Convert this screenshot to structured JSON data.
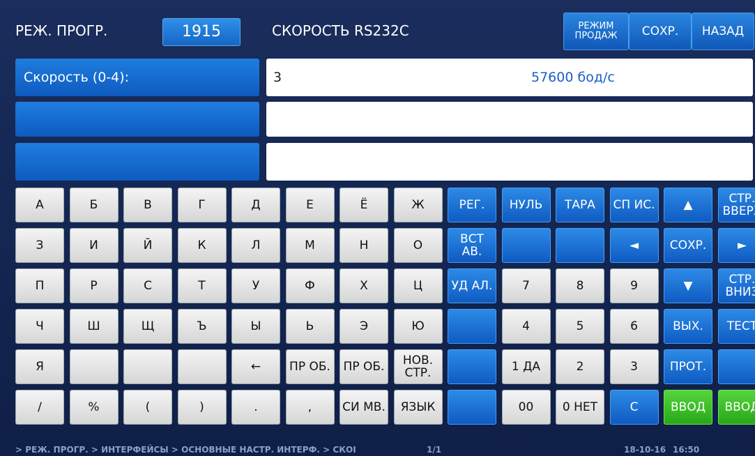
{
  "header": {
    "mode": "РЕЖ. ПРОГР.",
    "code": "1915",
    "title": "СКОРОСТЬ RS232C",
    "sale_mode": "РЕЖИМ ПРОДАЖ",
    "save": "СОХР.",
    "back": "НАЗАД"
  },
  "fields": [
    {
      "label": "Скорость (0-4):",
      "value": "3",
      "extra": "57600 бод/с"
    },
    {
      "label": "",
      "value": "",
      "extra": ""
    },
    {
      "label": "",
      "value": "",
      "extra": ""
    }
  ],
  "keyboard": {
    "rows": [
      [
        "А",
        "Б",
        "В",
        "Г",
        "Д",
        "Е",
        "Ё",
        "Ж",
        "РЕГ.",
        "НУЛЬ",
        "ТАРА",
        "СП ИС.",
        "▲",
        "СТР. ВВЕРХ"
      ],
      [
        "З",
        "И",
        "Й",
        "К",
        "Л",
        "М",
        "Н",
        "О",
        "ВСТ АВ.",
        "",
        "",
        "◄",
        "СОХР.",
        "►"
      ],
      [
        "П",
        "Р",
        "С",
        "Т",
        "У",
        "Ф",
        "Х",
        "Ц",
        "УД АЛ.",
        "7",
        "8",
        "9",
        "▼",
        "СТР. ВНИЗ"
      ],
      [
        "Ч",
        "Ш",
        "Щ",
        "Ъ",
        "Ы",
        "Ь",
        "Э",
        "Ю",
        "",
        "4",
        "5",
        "6",
        "ВЫХ.",
        "ТЕСТ"
      ],
      [
        "Я",
        "",
        "",
        "",
        "←",
        "ПР ОБ.",
        "ПР ОБ.",
        "НОВ. СТР.",
        "",
        "1 ДА",
        "2",
        "3",
        "ПРОТ.",
        ""
      ],
      [
        "/",
        "%",
        "(",
        ")",
        ".",
        ",",
        "СИ МВ.",
        "ЯЗЫК",
        "",
        "00",
        "0 НЕТ",
        "С",
        "ВВОД",
        "ВВОД"
      ]
    ]
  },
  "status": {
    "breadcrumb": "> РЕЖ. ПРОГР. > ИНТЕРФЕЙСЫ > ОСНОВНЫЕ НАСТР. ИНТЕРФ. > СКОI",
    "page": "1/1",
    "date": "18-10-16",
    "time": "16:50"
  }
}
